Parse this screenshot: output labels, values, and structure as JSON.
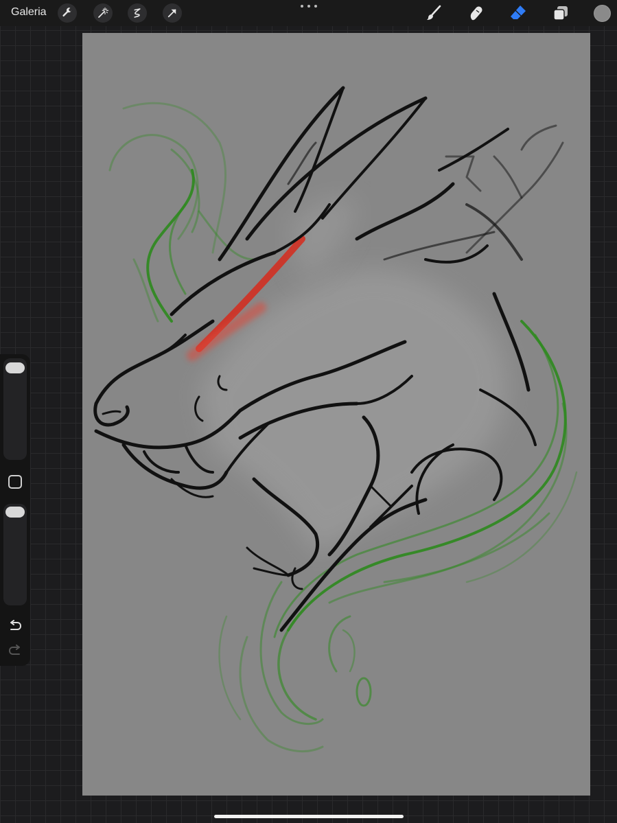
{
  "topbar": {
    "gallery_label": "Galeria",
    "left_tools": [
      "wrench-icon",
      "magic-wand-icon",
      "selection-s-icon",
      "transform-arrow-icon"
    ],
    "right_tools": [
      "brush-icon",
      "smudge-icon",
      "eraser-icon",
      "layers-icon"
    ],
    "active_tool": "eraser-icon",
    "active_color": "#8a8a8a",
    "accent_color": "#2f7cf6"
  },
  "canvas": {
    "background_color": "#878787",
    "artwork": "dragon-head-sketch",
    "stroke_colors": {
      "line": "#111111",
      "flame": "#2e8a1e",
      "eye": "#d62a1c"
    }
  },
  "sidebar": {
    "controls": [
      "brush-size-slider",
      "modify-button",
      "opacity-slider",
      "undo-button",
      "redo-button"
    ]
  }
}
